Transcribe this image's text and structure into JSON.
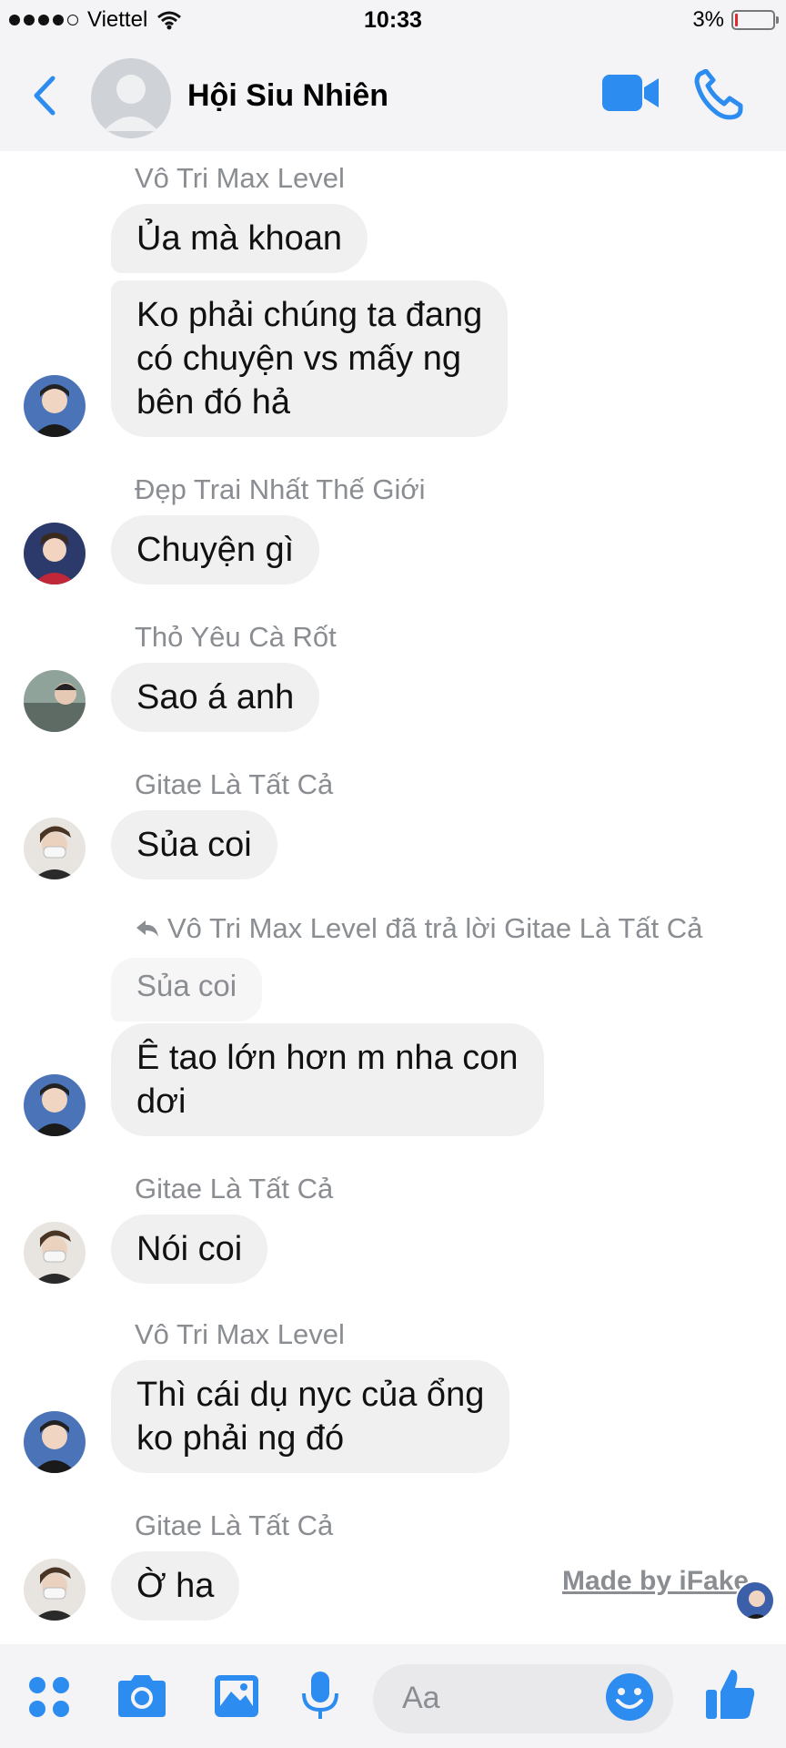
{
  "status_bar": {
    "carrier": "Viettel",
    "time": "10:33",
    "battery": "3%",
    "battery_level": 0.03
  },
  "header": {
    "title": "Hội Siu Nhiên",
    "icons": [
      "back-chevron-icon",
      "group-avatar",
      "video-call-icon",
      "phone-call-icon"
    ]
  },
  "messages": {
    "m1": {
      "sender": "Vô Tri Max Level",
      "b1": "Ủa mà khoan",
      "b2_l1": "Ko phải chúng ta đang",
      "b2_l2": "có chuyện vs mấy ng",
      "b2_l3": "bên đó hả"
    },
    "m2": {
      "sender": "Đẹp Trai Nhất Thế Giới",
      "text": "Chuyện gì"
    },
    "m3": {
      "sender": "Thỏ Yêu Cà Rốt",
      "text": "Sao á anh"
    },
    "m4": {
      "sender": "Gitae Là Tất Cả",
      "text": "Sủa coi"
    },
    "m5": {
      "reply_note": "Vô Tri Max Level đã trả lời Gitae Là Tất Cả",
      "quoted": "Sủa coi",
      "l1": "Ê tao lớn hơn m nha con",
      "l2": "dơi"
    },
    "m6": {
      "sender": "Gitae Là Tất Cả",
      "text": "Nói coi"
    },
    "m7": {
      "sender": "Vô Tri Max Level",
      "l1": "Thì cái dụ nyc của ổng",
      "l2": "ko phải ng đó"
    },
    "m8": {
      "sender": "Gitae Là Tất Cả",
      "text": "Ờ ha"
    }
  },
  "watermark": "Made by iFake",
  "composer": {
    "placeholder": "Aa",
    "icons": [
      "apps-grid-icon",
      "camera-icon",
      "gallery-icon",
      "microphone-icon",
      "emoji-icon",
      "thumbs-up-icon"
    ]
  },
  "colors": {
    "accent": "#2d8cf0",
    "bubble": "#f0f0f0",
    "sender_gray": "#8a8d91"
  }
}
